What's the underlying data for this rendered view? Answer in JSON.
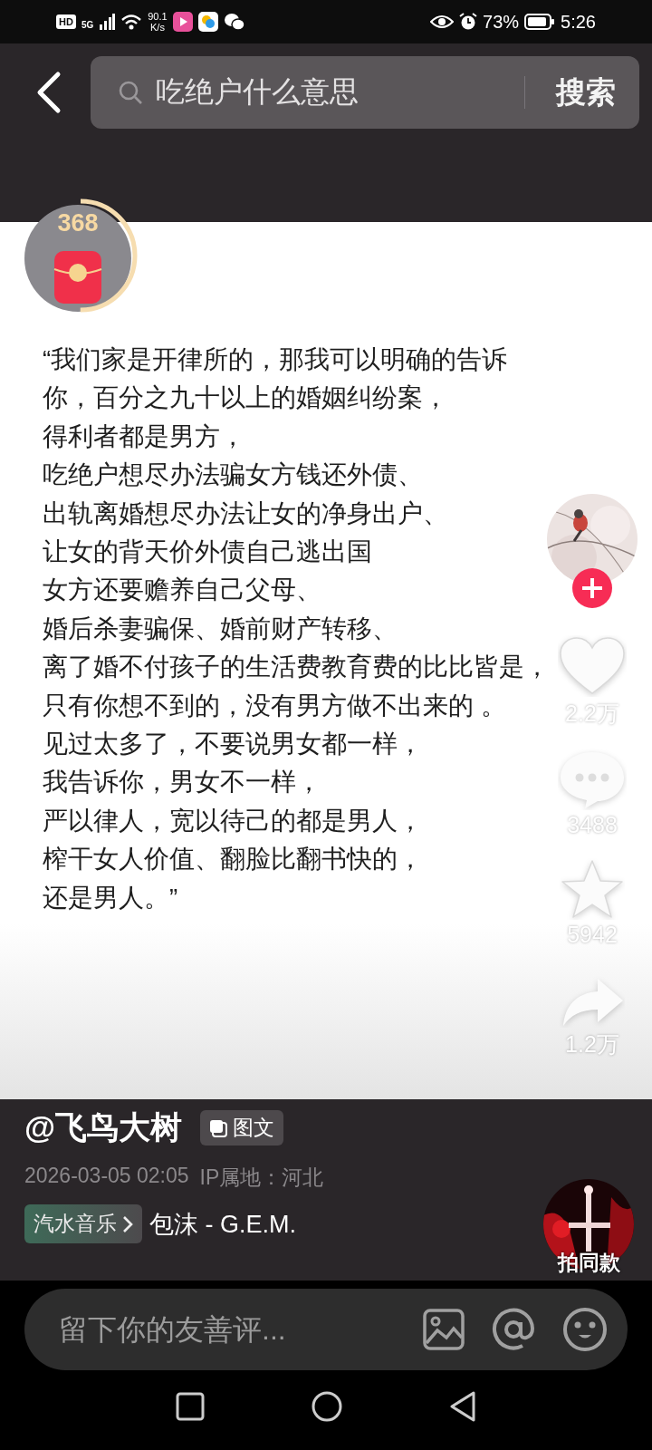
{
  "status_bar": {
    "hd": "HD",
    "network": "5G",
    "speed": "90.1",
    "speed_unit": "K/s",
    "battery": "73%",
    "time": "5:26"
  },
  "search": {
    "query": "吃绝户什么意思",
    "button": "搜索"
  },
  "badge": {
    "count": "368",
    "level": 0.5
  },
  "post": {
    "lines": [
      "“我们家是开律所的，那我可以明确的告诉",
      "你，百分之九十以上的婚姻纠纷案，",
      "得利者都是男方，",
      "吃绝户想尽办法骗女方钱还外债、",
      "出轨离婚想尽办法让女的净身出户、",
      "让女的背天价外债自己逃出国",
      "女方还要赡养自己父母、",
      "婚后杀妻骗保、婚前财产转移、",
      "离了婚不付孩子的生活费教育费的比比皆是，",
      "只有你想不到的，没有男方做不出来的 。",
      "见过太多了，不要说男女都一样，",
      "我告诉你，男女不一样，",
      "严以律人，宽以待己的都是男人，",
      "榨干女人价值、翻脸比翻书快的，",
      "还是男人。”"
    ]
  },
  "actions": [
    {
      "kind": "like",
      "count": "2.2万",
      "active": false
    },
    {
      "kind": "comment",
      "count": "3488"
    },
    {
      "kind": "favorite",
      "count": "5942",
      "active": false
    },
    {
      "kind": "share",
      "count": "1.2万"
    }
  ],
  "author": {
    "name": "@飞鸟大树",
    "tag": "图文",
    "date": "2026-03-05 02:05",
    "ip": "IP属地：河北",
    "music_tag": "汽水音乐",
    "song": "包沫 - G.E.M.",
    "same_style": "拍同款"
  },
  "comment": {
    "placeholder": "留下你的友善评..."
  }
}
